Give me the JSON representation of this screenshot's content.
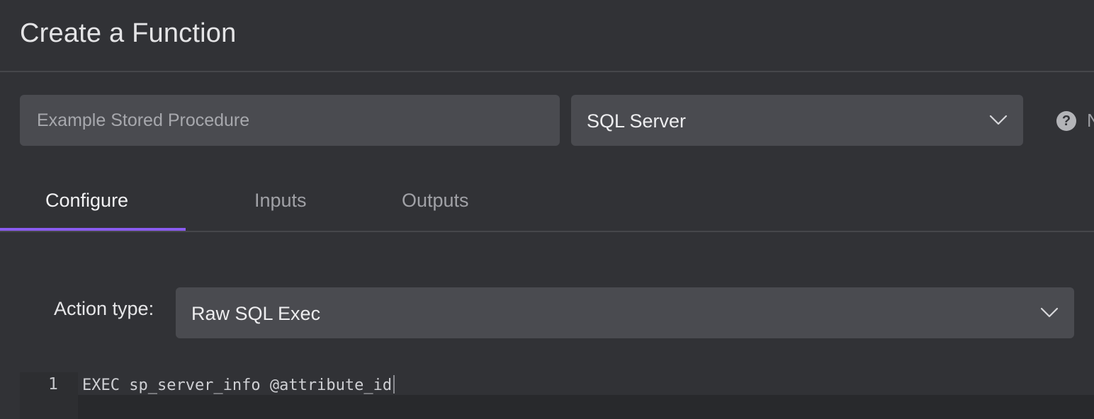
{
  "header": {
    "title": "Create a Function"
  },
  "form": {
    "name_input": {
      "placeholder": "Example Stored Procedure",
      "value": ""
    },
    "database_select": {
      "selected": "SQL Server",
      "icon": "chevron-down-icon"
    },
    "help": {
      "icon": "question-circle-icon",
      "symbol": "?",
      "text_fragment": "N"
    }
  },
  "tabs": [
    {
      "label": "Configure",
      "active": true
    },
    {
      "label": "Inputs",
      "active": false
    },
    {
      "label": "Outputs",
      "active": false
    }
  ],
  "configure": {
    "action_type_label": "Action type:",
    "action_type_selected": "Raw SQL Exec"
  },
  "editor": {
    "lines": [
      {
        "number": "1",
        "text": "EXEC sp_server_info @attribute_id"
      }
    ]
  },
  "colors": {
    "background": "#313236",
    "input_background": "#4a4b50",
    "accent": "#8a5cf0",
    "editor_background": "#28292c"
  }
}
